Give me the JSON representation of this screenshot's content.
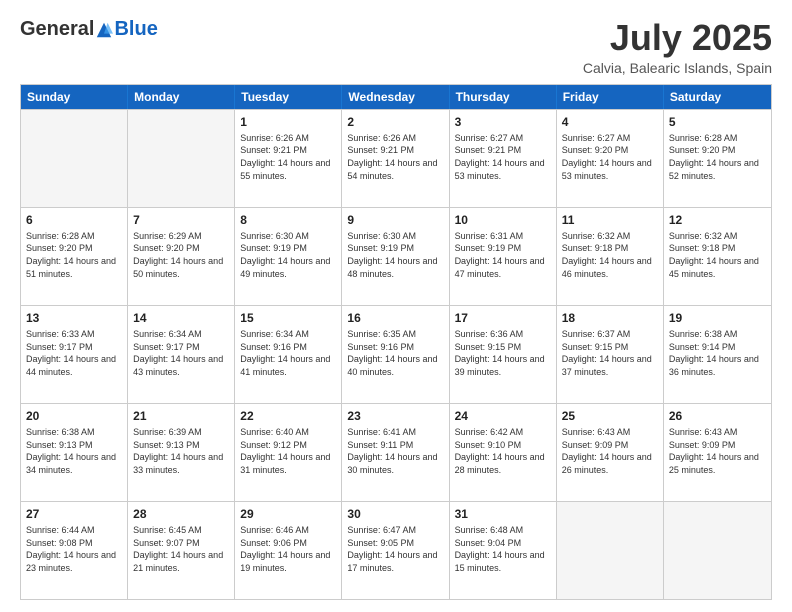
{
  "header": {
    "logo_general": "General",
    "logo_blue": "Blue",
    "title": "July 2025",
    "location": "Calvia, Balearic Islands, Spain"
  },
  "days_of_week": [
    "Sunday",
    "Monday",
    "Tuesday",
    "Wednesday",
    "Thursday",
    "Friday",
    "Saturday"
  ],
  "weeks": [
    [
      {
        "day": "",
        "empty": true
      },
      {
        "day": "",
        "empty": true
      },
      {
        "day": "1",
        "sunrise": "Sunrise: 6:26 AM",
        "sunset": "Sunset: 9:21 PM",
        "daylight": "Daylight: 14 hours and 55 minutes."
      },
      {
        "day": "2",
        "sunrise": "Sunrise: 6:26 AM",
        "sunset": "Sunset: 9:21 PM",
        "daylight": "Daylight: 14 hours and 54 minutes."
      },
      {
        "day": "3",
        "sunrise": "Sunrise: 6:27 AM",
        "sunset": "Sunset: 9:21 PM",
        "daylight": "Daylight: 14 hours and 53 minutes."
      },
      {
        "day": "4",
        "sunrise": "Sunrise: 6:27 AM",
        "sunset": "Sunset: 9:20 PM",
        "daylight": "Daylight: 14 hours and 53 minutes."
      },
      {
        "day": "5",
        "sunrise": "Sunrise: 6:28 AM",
        "sunset": "Sunset: 9:20 PM",
        "daylight": "Daylight: 14 hours and 52 minutes."
      }
    ],
    [
      {
        "day": "6",
        "sunrise": "Sunrise: 6:28 AM",
        "sunset": "Sunset: 9:20 PM",
        "daylight": "Daylight: 14 hours and 51 minutes."
      },
      {
        "day": "7",
        "sunrise": "Sunrise: 6:29 AM",
        "sunset": "Sunset: 9:20 PM",
        "daylight": "Daylight: 14 hours and 50 minutes."
      },
      {
        "day": "8",
        "sunrise": "Sunrise: 6:30 AM",
        "sunset": "Sunset: 9:19 PM",
        "daylight": "Daylight: 14 hours and 49 minutes."
      },
      {
        "day": "9",
        "sunrise": "Sunrise: 6:30 AM",
        "sunset": "Sunset: 9:19 PM",
        "daylight": "Daylight: 14 hours and 48 minutes."
      },
      {
        "day": "10",
        "sunrise": "Sunrise: 6:31 AM",
        "sunset": "Sunset: 9:19 PM",
        "daylight": "Daylight: 14 hours and 47 minutes."
      },
      {
        "day": "11",
        "sunrise": "Sunrise: 6:32 AM",
        "sunset": "Sunset: 9:18 PM",
        "daylight": "Daylight: 14 hours and 46 minutes."
      },
      {
        "day": "12",
        "sunrise": "Sunrise: 6:32 AM",
        "sunset": "Sunset: 9:18 PM",
        "daylight": "Daylight: 14 hours and 45 minutes."
      }
    ],
    [
      {
        "day": "13",
        "sunrise": "Sunrise: 6:33 AM",
        "sunset": "Sunset: 9:17 PM",
        "daylight": "Daylight: 14 hours and 44 minutes."
      },
      {
        "day": "14",
        "sunrise": "Sunrise: 6:34 AM",
        "sunset": "Sunset: 9:17 PM",
        "daylight": "Daylight: 14 hours and 43 minutes."
      },
      {
        "day": "15",
        "sunrise": "Sunrise: 6:34 AM",
        "sunset": "Sunset: 9:16 PM",
        "daylight": "Daylight: 14 hours and 41 minutes."
      },
      {
        "day": "16",
        "sunrise": "Sunrise: 6:35 AM",
        "sunset": "Sunset: 9:16 PM",
        "daylight": "Daylight: 14 hours and 40 minutes."
      },
      {
        "day": "17",
        "sunrise": "Sunrise: 6:36 AM",
        "sunset": "Sunset: 9:15 PM",
        "daylight": "Daylight: 14 hours and 39 minutes."
      },
      {
        "day": "18",
        "sunrise": "Sunrise: 6:37 AM",
        "sunset": "Sunset: 9:15 PM",
        "daylight": "Daylight: 14 hours and 37 minutes."
      },
      {
        "day": "19",
        "sunrise": "Sunrise: 6:38 AM",
        "sunset": "Sunset: 9:14 PM",
        "daylight": "Daylight: 14 hours and 36 minutes."
      }
    ],
    [
      {
        "day": "20",
        "sunrise": "Sunrise: 6:38 AM",
        "sunset": "Sunset: 9:13 PM",
        "daylight": "Daylight: 14 hours and 34 minutes."
      },
      {
        "day": "21",
        "sunrise": "Sunrise: 6:39 AM",
        "sunset": "Sunset: 9:13 PM",
        "daylight": "Daylight: 14 hours and 33 minutes."
      },
      {
        "day": "22",
        "sunrise": "Sunrise: 6:40 AM",
        "sunset": "Sunset: 9:12 PM",
        "daylight": "Daylight: 14 hours and 31 minutes."
      },
      {
        "day": "23",
        "sunrise": "Sunrise: 6:41 AM",
        "sunset": "Sunset: 9:11 PM",
        "daylight": "Daylight: 14 hours and 30 minutes."
      },
      {
        "day": "24",
        "sunrise": "Sunrise: 6:42 AM",
        "sunset": "Sunset: 9:10 PM",
        "daylight": "Daylight: 14 hours and 28 minutes."
      },
      {
        "day": "25",
        "sunrise": "Sunrise: 6:43 AM",
        "sunset": "Sunset: 9:09 PM",
        "daylight": "Daylight: 14 hours and 26 minutes."
      },
      {
        "day": "26",
        "sunrise": "Sunrise: 6:43 AM",
        "sunset": "Sunset: 9:09 PM",
        "daylight": "Daylight: 14 hours and 25 minutes."
      }
    ],
    [
      {
        "day": "27",
        "sunrise": "Sunrise: 6:44 AM",
        "sunset": "Sunset: 9:08 PM",
        "daylight": "Daylight: 14 hours and 23 minutes."
      },
      {
        "day": "28",
        "sunrise": "Sunrise: 6:45 AM",
        "sunset": "Sunset: 9:07 PM",
        "daylight": "Daylight: 14 hours and 21 minutes."
      },
      {
        "day": "29",
        "sunrise": "Sunrise: 6:46 AM",
        "sunset": "Sunset: 9:06 PM",
        "daylight": "Daylight: 14 hours and 19 minutes."
      },
      {
        "day": "30",
        "sunrise": "Sunrise: 6:47 AM",
        "sunset": "Sunset: 9:05 PM",
        "daylight": "Daylight: 14 hours and 17 minutes."
      },
      {
        "day": "31",
        "sunrise": "Sunrise: 6:48 AM",
        "sunset": "Sunset: 9:04 PM",
        "daylight": "Daylight: 14 hours and 15 minutes."
      },
      {
        "day": "",
        "empty": true
      },
      {
        "day": "",
        "empty": true
      }
    ]
  ]
}
